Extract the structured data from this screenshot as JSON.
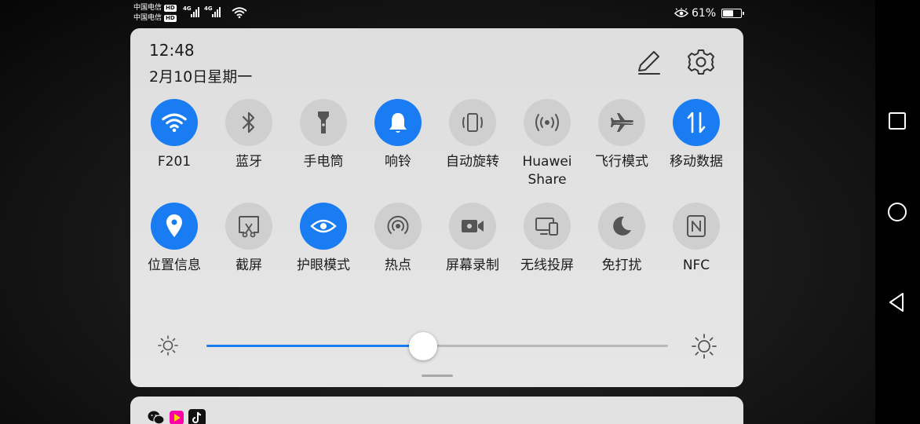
{
  "status_bar": {
    "carrier_1": "中国电信",
    "carrier_2": "中国电信",
    "hd_label": "HD",
    "network_1": "4G",
    "network_2": "4G",
    "battery_percent": "61%",
    "battery_level": 0.61,
    "icons": [
      "signal-icon",
      "wifi-icon",
      "eye-comfort-icon",
      "battery-icon"
    ]
  },
  "panel": {
    "time": "12:48",
    "date": "2月10日星期一",
    "header_icons": [
      "edit-icon",
      "gear-icon"
    ]
  },
  "tiles": [
    {
      "label": "F201",
      "icon": "wifi-icon",
      "active": true
    },
    {
      "label": "蓝牙",
      "icon": "bluetooth-icon",
      "active": false
    },
    {
      "label": "手电筒",
      "icon": "flashlight-icon",
      "active": false
    },
    {
      "label": "响铃",
      "icon": "bell-icon",
      "active": true
    },
    {
      "label": "自动旋转",
      "icon": "auto-rotate-icon",
      "active": false
    },
    {
      "label": "Huawei\nShare",
      "icon": "huawei-share-icon",
      "active": false
    },
    {
      "label": "飞行模式",
      "icon": "airplane-icon",
      "active": false
    },
    {
      "label": "移动数据",
      "icon": "mobile-data-icon",
      "active": true
    },
    {
      "label": "位置信息",
      "icon": "location-icon",
      "active": true
    },
    {
      "label": "截屏",
      "icon": "screenshot-icon",
      "active": false
    },
    {
      "label": "护眼模式",
      "icon": "eye-icon",
      "active": true
    },
    {
      "label": "热点",
      "icon": "hotspot-icon",
      "active": false
    },
    {
      "label": "屏幕录制",
      "icon": "screen-record-icon",
      "active": false
    },
    {
      "label": "无线投屏",
      "icon": "wireless-projection-icon",
      "active": false
    },
    {
      "label": "免打扰",
      "icon": "moon-icon",
      "active": false
    },
    {
      "label": "NFC",
      "icon": "nfc-icon",
      "active": false
    }
  ],
  "brightness": {
    "level": 0.47,
    "accent_color": "#1a7cf3",
    "icons": [
      "brightness-low-icon",
      "brightness-high-icon"
    ]
  },
  "notifications": {
    "app_icons": [
      "wechat-icon",
      "video-app-icon",
      "tiktok-icon"
    ]
  },
  "nav_bar": {
    "buttons": [
      "recents-square-icon",
      "home-circle-icon",
      "back-triangle-icon"
    ]
  },
  "colors": {
    "accent": "#1a7cf3",
    "tile_off": "#cfcfcf",
    "panel_bg": "#e3e3e3"
  }
}
